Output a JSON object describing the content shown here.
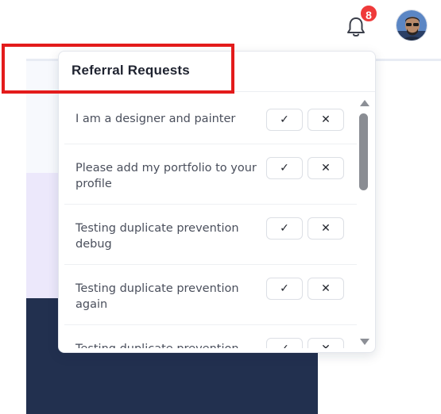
{
  "header": {
    "notification_count": "8",
    "bell_icon": "bell-icon",
    "avatar_icon": "user-avatar"
  },
  "dropdown": {
    "title": "Referral Requests",
    "items": [
      {
        "text": "I am a designer and painter",
        "accept": "✓",
        "reject": "✕"
      },
      {
        "text": "Please add my portfolio to your profile",
        "accept": "✓",
        "reject": "✕"
      },
      {
        "text": "Testing duplicate prevention debug",
        "accept": "✓",
        "reject": "✕"
      },
      {
        "text": "Testing duplicate prevention again",
        "accept": "✓",
        "reject": "✕"
      },
      {
        "text": "Testing duplicate prevention",
        "accept": "✓",
        "reject": "✕"
      }
    ]
  },
  "colors": {
    "badge": "#ef3a3a",
    "highlight": "#e31b1b",
    "dark_panel": "#22304f",
    "lavender_panel": "#ece8fb"
  }
}
